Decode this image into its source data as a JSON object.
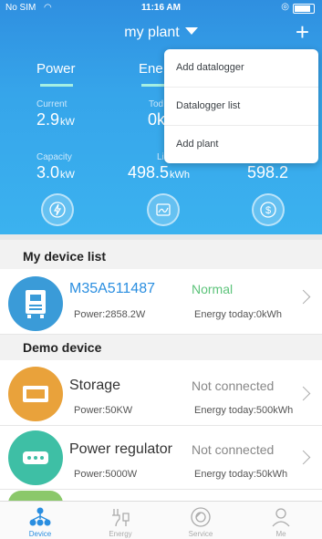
{
  "status_bar": {
    "carrier": "No SIM",
    "time": "11:16 AM"
  },
  "nav": {
    "title": "my plant"
  },
  "tabs": {
    "power": "Power",
    "energy": "Ene"
  },
  "stats": {
    "current_label": "Current",
    "current_value": "2.9",
    "current_unit": "kW",
    "today_label": "Tod",
    "today_value": "0k",
    "capacity_label": "Capacity",
    "capacity_value": "3.0",
    "capacity_unit": "kW",
    "lifetime_label": "Lifet",
    "lifetime_value": "498.5",
    "lifetime_unit": "kWh",
    "revenue_value": "598.2"
  },
  "dropdown": {
    "items": [
      "Add datalogger",
      "Datalogger list",
      "Add plant"
    ]
  },
  "my_device_list": {
    "title": "My device list",
    "device": {
      "name": "M35A511487",
      "status": "Normal",
      "power": "Power:2858.2W",
      "energy": "Energy today:0kWh",
      "name_color": "#2a8ee0",
      "status_color": "#5cc37a"
    }
  },
  "demo": {
    "title": "Demo device",
    "devices": [
      {
        "name": "Storage",
        "status": "Not connected",
        "power": "Power:50KW",
        "energy": "Energy today:500kWh",
        "icon_color": "#e9a23b"
      },
      {
        "name": "Power regulator",
        "status": "Not connected",
        "power": "Power:5000W",
        "energy": "Energy today:50kWh",
        "icon_color": "#3ebfa5"
      }
    ]
  },
  "tabbar": [
    {
      "label": "Device",
      "icon": "device-icon",
      "active": true
    },
    {
      "label": "Energy",
      "icon": "energy-icon",
      "active": false
    },
    {
      "label": "Service",
      "icon": "service-icon",
      "active": false
    },
    {
      "label": "Me",
      "icon": "me-icon",
      "active": false
    }
  ]
}
